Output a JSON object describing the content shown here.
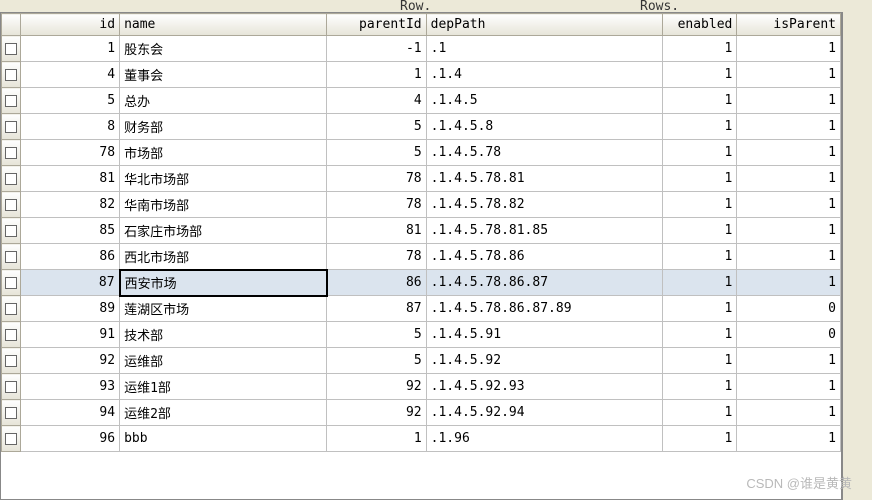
{
  "toolbar": {
    "label1": "Row.",
    "label2": "Rows."
  },
  "columns": {
    "rowHead": "",
    "id": "id",
    "name": "name",
    "parentId": "parentId",
    "depPath": "depPath",
    "enabled": "enabled",
    "isParent": "isParent"
  },
  "rows": [
    {
      "id": "1",
      "name": "股东会",
      "parentId": "-1",
      "depPath": ".1",
      "enabled": "1",
      "isParent": "1",
      "selected": false
    },
    {
      "id": "4",
      "name": "董事会",
      "parentId": "1",
      "depPath": ".1.4",
      "enabled": "1",
      "isParent": "1",
      "selected": false
    },
    {
      "id": "5",
      "name": "总办",
      "parentId": "4",
      "depPath": ".1.4.5",
      "enabled": "1",
      "isParent": "1",
      "selected": false
    },
    {
      "id": "8",
      "name": "财务部",
      "parentId": "5",
      "depPath": ".1.4.5.8",
      "enabled": "1",
      "isParent": "1",
      "selected": false
    },
    {
      "id": "78",
      "name": "市场部",
      "parentId": "5",
      "depPath": ".1.4.5.78",
      "enabled": "1",
      "isParent": "1",
      "selected": false
    },
    {
      "id": "81",
      "name": "华北市场部",
      "parentId": "78",
      "depPath": ".1.4.5.78.81",
      "enabled": "1",
      "isParent": "1",
      "selected": false
    },
    {
      "id": "82",
      "name": "华南市场部",
      "parentId": "78",
      "depPath": ".1.4.5.78.82",
      "enabled": "1",
      "isParent": "1",
      "selected": false
    },
    {
      "id": "85",
      "name": "石家庄市场部",
      "parentId": "81",
      "depPath": ".1.4.5.78.81.85",
      "enabled": "1",
      "isParent": "1",
      "selected": false
    },
    {
      "id": "86",
      "name": "西北市场部",
      "parentId": "78",
      "depPath": ".1.4.5.78.86",
      "enabled": "1",
      "isParent": "1",
      "selected": false
    },
    {
      "id": "87",
      "name": "西安市场",
      "parentId": "86",
      "depPath": ".1.4.5.78.86.87",
      "enabled": "1",
      "isParent": "1",
      "selected": true
    },
    {
      "id": "89",
      "name": "莲湖区市场",
      "parentId": "87",
      "depPath": ".1.4.5.78.86.87.89",
      "enabled": "1",
      "isParent": "0",
      "selected": false
    },
    {
      "id": "91",
      "name": "技术部",
      "parentId": "5",
      "depPath": ".1.4.5.91",
      "enabled": "1",
      "isParent": "0",
      "selected": false
    },
    {
      "id": "92",
      "name": "运维部",
      "parentId": "5",
      "depPath": ".1.4.5.92",
      "enabled": "1",
      "isParent": "1",
      "selected": false
    },
    {
      "id": "93",
      "name": "运维1部",
      "parentId": "92",
      "depPath": ".1.4.5.92.93",
      "enabled": "1",
      "isParent": "1",
      "selected": false
    },
    {
      "id": "94",
      "name": "运维2部",
      "parentId": "92",
      "depPath": ".1.4.5.92.94",
      "enabled": "1",
      "isParent": "1",
      "selected": false
    },
    {
      "id": "96",
      "name": "bbb",
      "parentId": "1",
      "depPath": ".1.96",
      "enabled": "1",
      "isParent": "1",
      "selected": false
    }
  ],
  "watermark": "CSDN @谁是黄黄"
}
